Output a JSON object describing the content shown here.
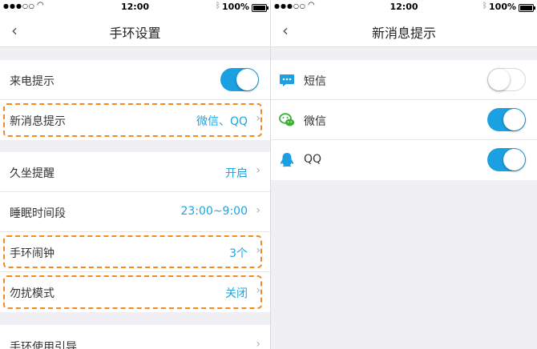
{
  "status_bar": {
    "time": "12:00",
    "battery": "100%"
  },
  "left": {
    "title": "手环设置",
    "incoming_call": {
      "label": "来电提示",
      "on": true
    },
    "new_message": {
      "label": "新消息提示",
      "value": "微信、QQ"
    },
    "sedentary": {
      "label": "久坐提醒",
      "value": "开启"
    },
    "sleep": {
      "label": "睡眠时间段",
      "value": "23:00~9:00"
    },
    "alarm": {
      "label": "手环闹钟",
      "value": "3个"
    },
    "dnd": {
      "label": "勿扰模式",
      "value": "关闭"
    },
    "guide": {
      "label": "手环使用引导"
    }
  },
  "right": {
    "title": "新消息提示",
    "items": [
      {
        "label": "短信",
        "on": false,
        "icon": "sms-icon"
      },
      {
        "label": "微信",
        "on": true,
        "icon": "wechat-icon"
      },
      {
        "label": "QQ",
        "on": true,
        "icon": "qq-icon"
      }
    ]
  },
  "colors": {
    "accent": "#1ba1e2",
    "value_text": "#1ca5e0",
    "highlight": "#f5881f",
    "background": "#efeff4"
  }
}
